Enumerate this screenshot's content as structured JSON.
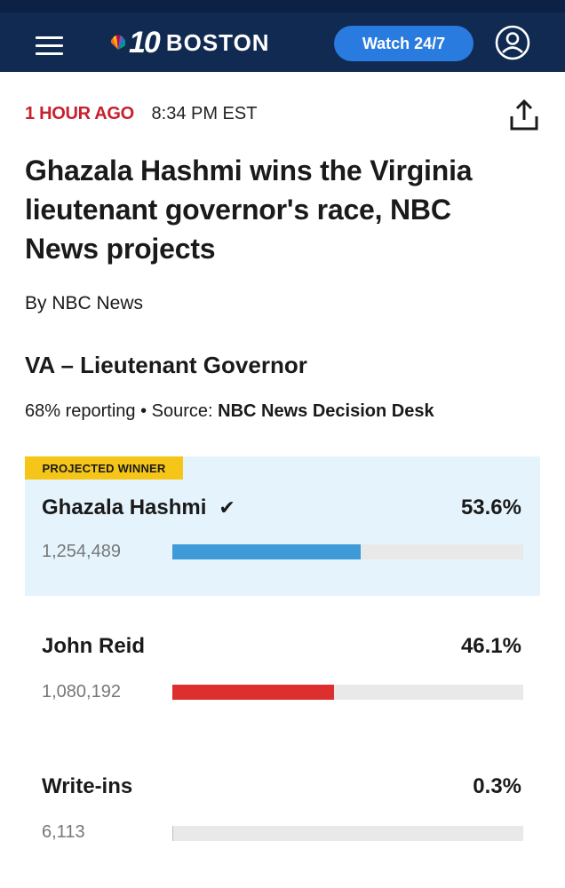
{
  "header": {
    "logo_number": "10",
    "logo_city": "BOSTON",
    "watch_label": "Watch 24/7"
  },
  "article": {
    "time_ago": "1 HOUR AGO",
    "timestamp": "8:34 PM EST",
    "headline": "Ghazala Hashmi wins the Virginia lieutenant governor's race, NBC News projects",
    "byline": "By NBC News"
  },
  "race": {
    "title": "VA – Lieutenant Governor",
    "reporting": "68% reporting",
    "source_label": "Source:",
    "source_name": "NBC News Decision Desk",
    "winner_badge": "PROJECTED WINNER",
    "candidates": [
      {
        "name": "Ghazala Hashmi",
        "percent": "53.6%",
        "votes": "1,254,489",
        "share": 0.536,
        "color": "#3f9ad8",
        "winner": true
      },
      {
        "name": "John Reid",
        "percent": "46.1%",
        "votes": "1,080,192",
        "share": 0.461,
        "color": "#de2f2f",
        "winner": false
      },
      {
        "name": "Write-ins",
        "percent": "0.3%",
        "votes": "6,113",
        "share": 0.003,
        "color": "#c0c0c0",
        "winner": false
      }
    ]
  },
  "colors": {
    "header_bg": "#112a52",
    "accent_red": "#c8202e",
    "watch_button": "#2a7be0",
    "winner_bg": "#e5f4fc",
    "winner_badge": "#f5c518"
  }
}
